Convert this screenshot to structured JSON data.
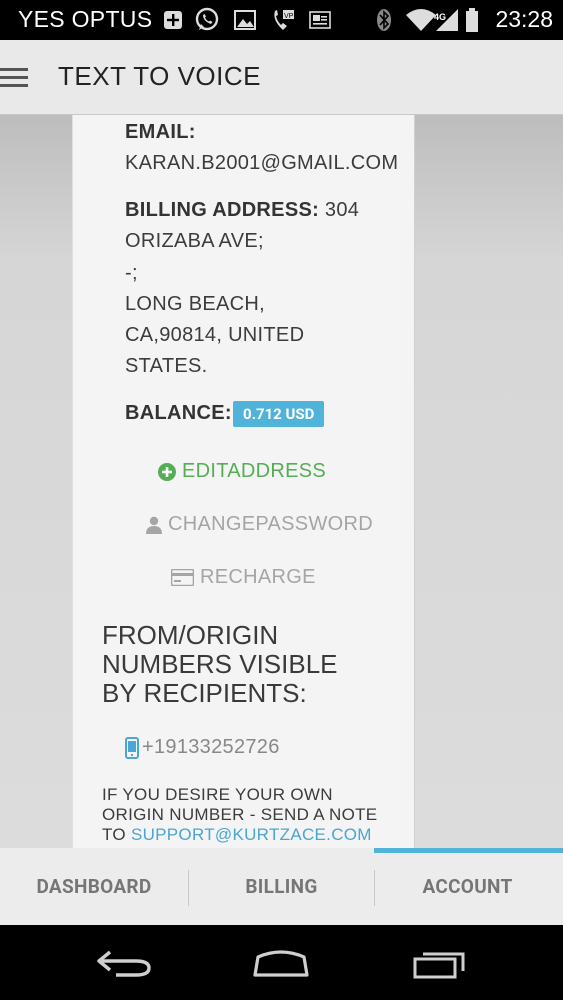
{
  "status": {
    "carrier": "YES OPTUS",
    "time": "23:28",
    "icons": [
      "plus-icon",
      "whatsapp-icon",
      "image-icon",
      "voicemail-icon",
      "gallery-icon",
      "bluetooth-icon",
      "wifi-icon",
      "signal-icon",
      "battery-icon"
    ]
  },
  "app": {
    "title": "TEXT TO VOICE"
  },
  "account": {
    "email_label": "EMAIL:",
    "email_value": "KARAN.B2001@GMAIL.COM",
    "billing_label": "BILLING ADDRESS:",
    "billing_line1": "304",
    "billing_line2": "ORIZABA AVE;",
    "billing_line3": "-;",
    "billing_line4": "LONG BEACH,",
    "billing_line5": "CA,90814, UNITED",
    "billing_line6": "STATES.",
    "balance_label": "BALANCE:",
    "balance_value": "0.712 USD",
    "edit_address": "EDITADDRESS",
    "change_password": "CHANGEPASSWORD",
    "recharge": "RECHARGE",
    "origin_heading_1": "FROM/ORIGIN",
    "origin_heading_2": "NUMBERS VISIBLE",
    "origin_heading_3": "BY RECIPIENTS:",
    "origin_number": "+19133252726",
    "note_1": "IF YOU DESIRE YOUR OWN",
    "note_2": "ORIGIN NUMBER - SEND A NOTE",
    "note_3_prefix": "TO ",
    "support_email": "SUPPORT@KURTZACE.COM"
  },
  "tabs": [
    {
      "label": "DASHBOARD"
    },
    {
      "label": "BILLING"
    },
    {
      "label": "ACCOUNT",
      "active": true
    }
  ],
  "colors": {
    "accent": "#4fb3da",
    "green": "#55ae55",
    "link": "#4aa6d3"
  }
}
